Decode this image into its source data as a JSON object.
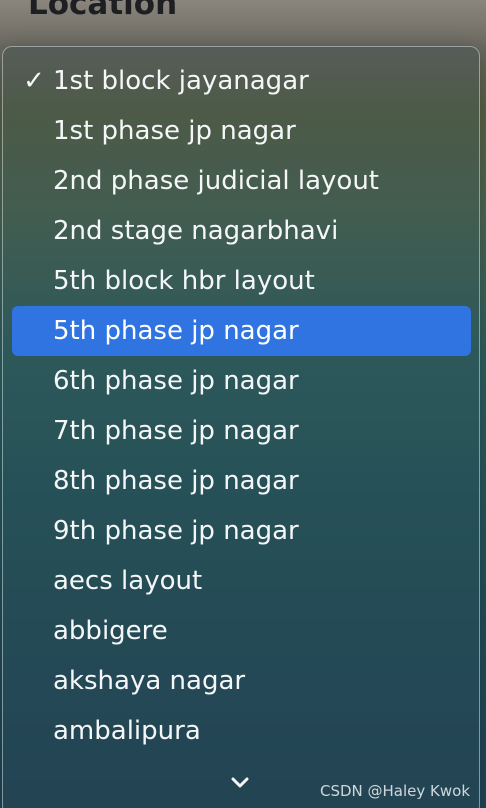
{
  "heading": "Location",
  "menu": {
    "selected_index": 0,
    "highlighted_index": 5,
    "items": [
      {
        "label": "1st block jayanagar",
        "check": "✓"
      },
      {
        "label": "1st phase jp nagar",
        "check": ""
      },
      {
        "label": "2nd phase judicial layout",
        "check": ""
      },
      {
        "label": "2nd stage nagarbhavi",
        "check": ""
      },
      {
        "label": "5th block hbr layout",
        "check": ""
      },
      {
        "label": "5th phase jp nagar",
        "check": ""
      },
      {
        "label": "6th phase jp nagar",
        "check": ""
      },
      {
        "label": "7th phase jp nagar",
        "check": ""
      },
      {
        "label": "8th phase jp nagar",
        "check": ""
      },
      {
        "label": "9th phase jp nagar",
        "check": ""
      },
      {
        "label": "aecs layout",
        "check": ""
      },
      {
        "label": "abbigere",
        "check": ""
      },
      {
        "label": "akshaya nagar",
        "check": ""
      },
      {
        "label": "ambalipura",
        "check": ""
      }
    ],
    "scroll_icon": "chevron-down-icon"
  },
  "watermark": "CSDN @Haley Kwok",
  "colors": {
    "highlight": "#2f74e0",
    "text": "#f4f6f7"
  }
}
